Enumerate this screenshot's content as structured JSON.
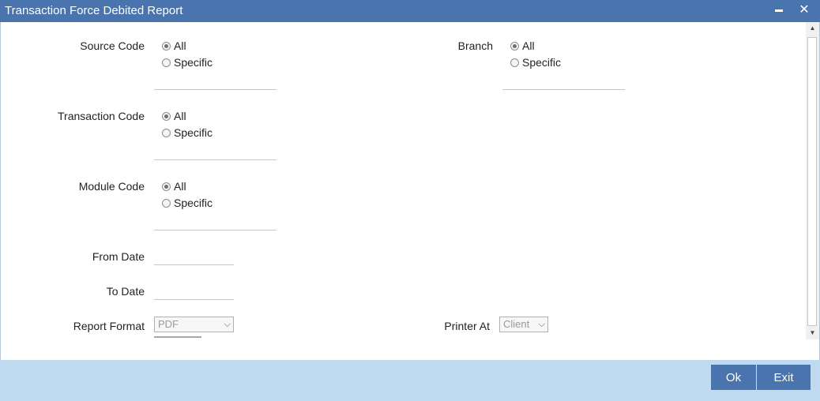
{
  "window": {
    "title": "Transaction Force Debited Report",
    "minimize_glyph": "▬",
    "close_glyph": "✕"
  },
  "form": {
    "source_code": {
      "label": "Source Code",
      "opt_all": "All",
      "opt_specific": "Specific",
      "selected": "All"
    },
    "branch": {
      "label": "Branch",
      "opt_all": "All",
      "opt_specific": "Specific",
      "selected": "All"
    },
    "transaction_code": {
      "label": "Transaction Code",
      "opt_all": "All",
      "opt_specific": "Specific",
      "selected": "All"
    },
    "module_code": {
      "label": "Module Code",
      "opt_all": "All",
      "opt_specific": "Specific",
      "selected": "All"
    },
    "from_date": {
      "label": "From Date",
      "value": ""
    },
    "to_date": {
      "label": "To Date",
      "value": ""
    },
    "report_format": {
      "label": "Report Format",
      "value": "PDF"
    },
    "printer_at": {
      "label": "Printer At",
      "value": "Client"
    }
  },
  "footer": {
    "ok_label": "Ok",
    "exit_label": "Exit"
  },
  "colors": {
    "titlebar": "#4a74ad",
    "footer": "#c0dbf0",
    "button": "#4a74ad"
  }
}
